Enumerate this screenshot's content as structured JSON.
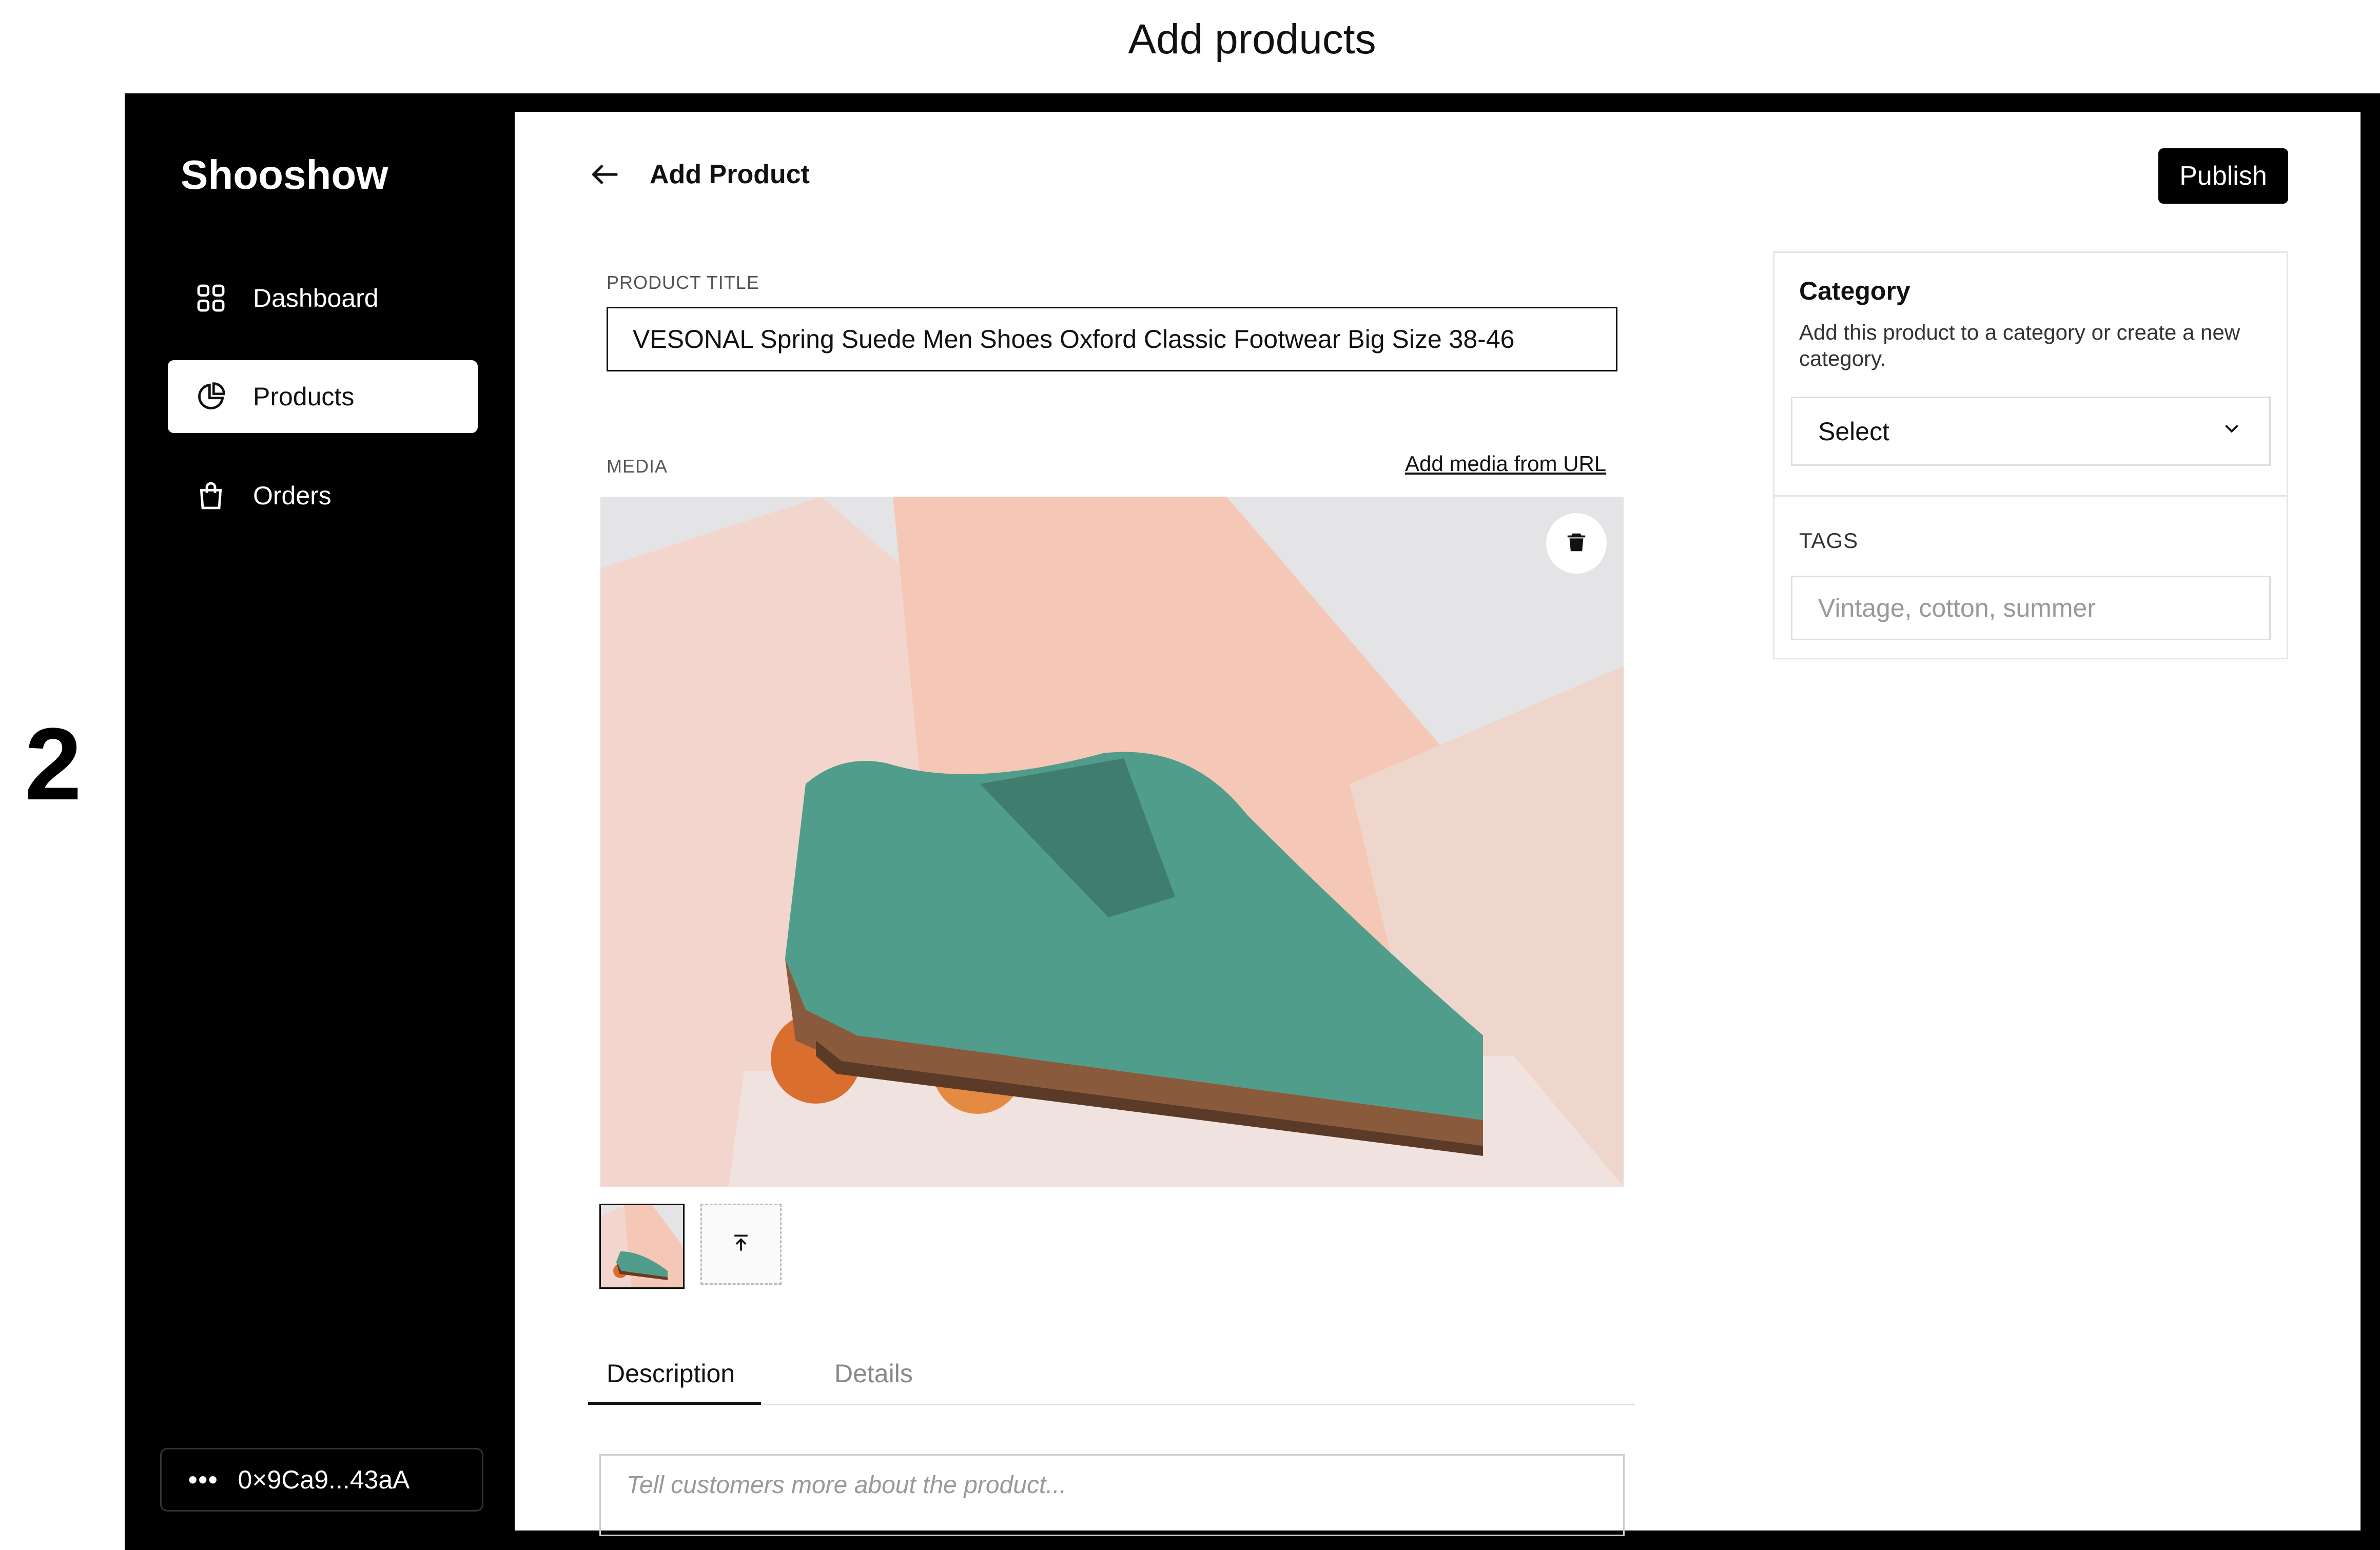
{
  "page_heading": "Add products",
  "step_number": "2",
  "sidebar": {
    "brand": "Shooshow",
    "items": [
      {
        "label": "Dashboard",
        "icon": "grid-icon"
      },
      {
        "label": "Products",
        "icon": "pie-chart-icon",
        "active": true
      },
      {
        "label": "Orders",
        "icon": "shopping-bag-icon"
      }
    ],
    "wallet": {
      "dots": "•••",
      "address": "0×9Ca9...43aA"
    }
  },
  "header": {
    "title": "Add Product",
    "publish_label": "Publish"
  },
  "product_title": {
    "label": "PRODUCT TITLE",
    "value": "VESONAL Spring Suede Men Shoes Oxford Classic Footwear Big Size 38-46"
  },
  "media": {
    "label": "MEDIA",
    "add_url_label": "Add media from URL"
  },
  "tabs": [
    {
      "label": "Description",
      "active": true
    },
    {
      "label": "Details"
    }
  ],
  "description": {
    "placeholder": "Tell customers more about the product..."
  },
  "category": {
    "heading": "Category",
    "help": "Add this product to a category or create a new category.",
    "select_value": "Select",
    "tags_label": "TAGS",
    "tags_placeholder": "Vintage, cotton, summer"
  },
  "colors": {
    "accent": "#000000",
    "shoe": "#4f9d8a",
    "peach": "#e9884a"
  }
}
